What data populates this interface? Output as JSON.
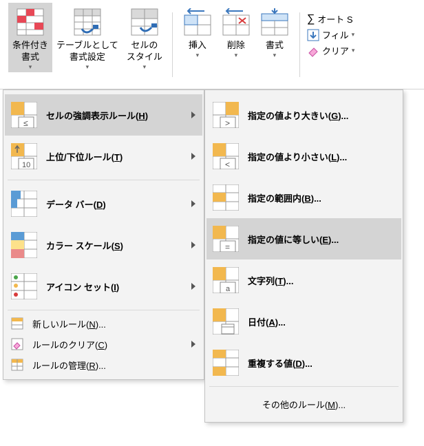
{
  "ribbon": {
    "conditional_format": "条件付き\n書式",
    "table_format": "テーブルとして\n書式設定",
    "cell_styles": "セルの\nスタイル",
    "insert": "挿入",
    "delete": "削除",
    "format": "書式",
    "autosum": "オート S",
    "fill": "フィル",
    "clear": "クリア"
  },
  "menu1": {
    "highlight_rules": "セルの強調表示ルール(",
    "highlight_rules_key": "H",
    "top_bottom": "上位/下位ルール(",
    "top_bottom_key": "T",
    "data_bars": "データ バー(",
    "data_bars_key": "D",
    "color_scales": "カラー スケール(",
    "color_scales_key": "S",
    "icon_sets": "アイコン セット(",
    "icon_sets_key": "I",
    "new_rule": "新しいルール(",
    "new_rule_key": "N",
    "clear_rules": "ルールのクリア(",
    "clear_rules_key": "C",
    "manage_rules": "ルールの管理(",
    "manage_rules_key": "R",
    "close": ")",
    "ellipsis": ")..."
  },
  "menu2": {
    "greater": "指定の値より大きい(",
    "greater_key": "G",
    "less": "指定の値より小さい(",
    "less_key": "L",
    "between": "指定の範囲内(",
    "between_key": "B",
    "equal": "指定の値に等しい(",
    "equal_key": "E",
    "text": "文字列(",
    "text_key": "T",
    "date": "日付(",
    "date_key": "A",
    "duplicate": "重複する値(",
    "duplicate_key": "D",
    "more": "その他のルール(",
    "more_key": "M",
    "ellipsis": ")..."
  }
}
